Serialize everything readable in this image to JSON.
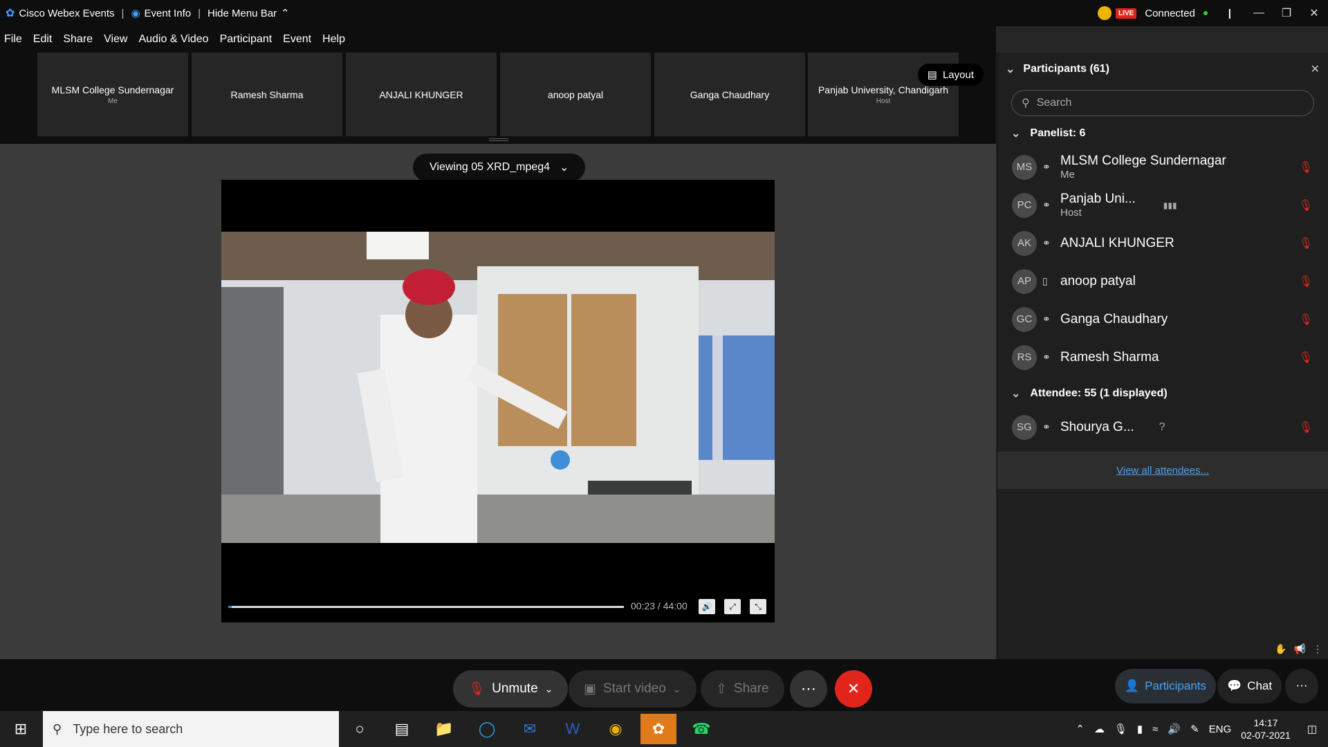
{
  "titlebar": {
    "app_name": "Cisco Webex Events",
    "event_info": "Event Info",
    "hide_menu": "Hide Menu Bar",
    "live_badge": "LIVE",
    "status": "Connected"
  },
  "menu": [
    "File",
    "Edit",
    "Share",
    "View",
    "Audio & Video",
    "Participant",
    "Event",
    "Help"
  ],
  "thumbnails": [
    {
      "name": "MLSM College Sundernagar",
      "sub": "Me"
    },
    {
      "name": "Ramesh Sharma",
      "sub": ""
    },
    {
      "name": "ANJALI KHUNGER",
      "sub": ""
    },
    {
      "name": "anoop patyal",
      "sub": ""
    },
    {
      "name": "Ganga Chaudhary",
      "sub": ""
    },
    {
      "name": "Panjab University, Chandigarh",
      "sub": "Host"
    }
  ],
  "layout_label": "Layout",
  "viewing_label": "Viewing 05 XRD_mpeg4",
  "player": {
    "time": "00:23 / 44:00",
    "progress": 0.0087
  },
  "controls": {
    "unmute": "Unmute",
    "start_video": "Start video",
    "share": "Share",
    "participants": "Participants",
    "chat": "Chat"
  },
  "panel": {
    "title": "Participants (61)",
    "search_placeholder": "Search",
    "panelist_header": "Panelist: 6",
    "attendee_header": "Attendee: 55 (1 displayed)",
    "view_all": "View all attendees..."
  },
  "panelists": [
    {
      "initials": "MS",
      "name": "MLSM College Sundernagar",
      "sub": "Me"
    },
    {
      "initials": "PC",
      "name": "Panjab Uni...",
      "sub": "Host"
    },
    {
      "initials": "AK",
      "name": "ANJALI KHUNGER",
      "sub": ""
    },
    {
      "initials": "AP",
      "name": "anoop patyal",
      "sub": ""
    },
    {
      "initials": "GC",
      "name": "Ganga Chaudhary",
      "sub": ""
    },
    {
      "initials": "RS",
      "name": "Ramesh Sharma",
      "sub": ""
    }
  ],
  "attendees": [
    {
      "initials": "SG",
      "name": "Shourya G...",
      "sub": ""
    }
  ],
  "taskbar": {
    "search_placeholder": "Type here to search",
    "lang": "ENG",
    "time": "14:17",
    "date": "02-07-2021"
  },
  "colors": {
    "accent": "#4aa3f0",
    "danger": "#e1251b",
    "progress": "#2b8be5"
  }
}
